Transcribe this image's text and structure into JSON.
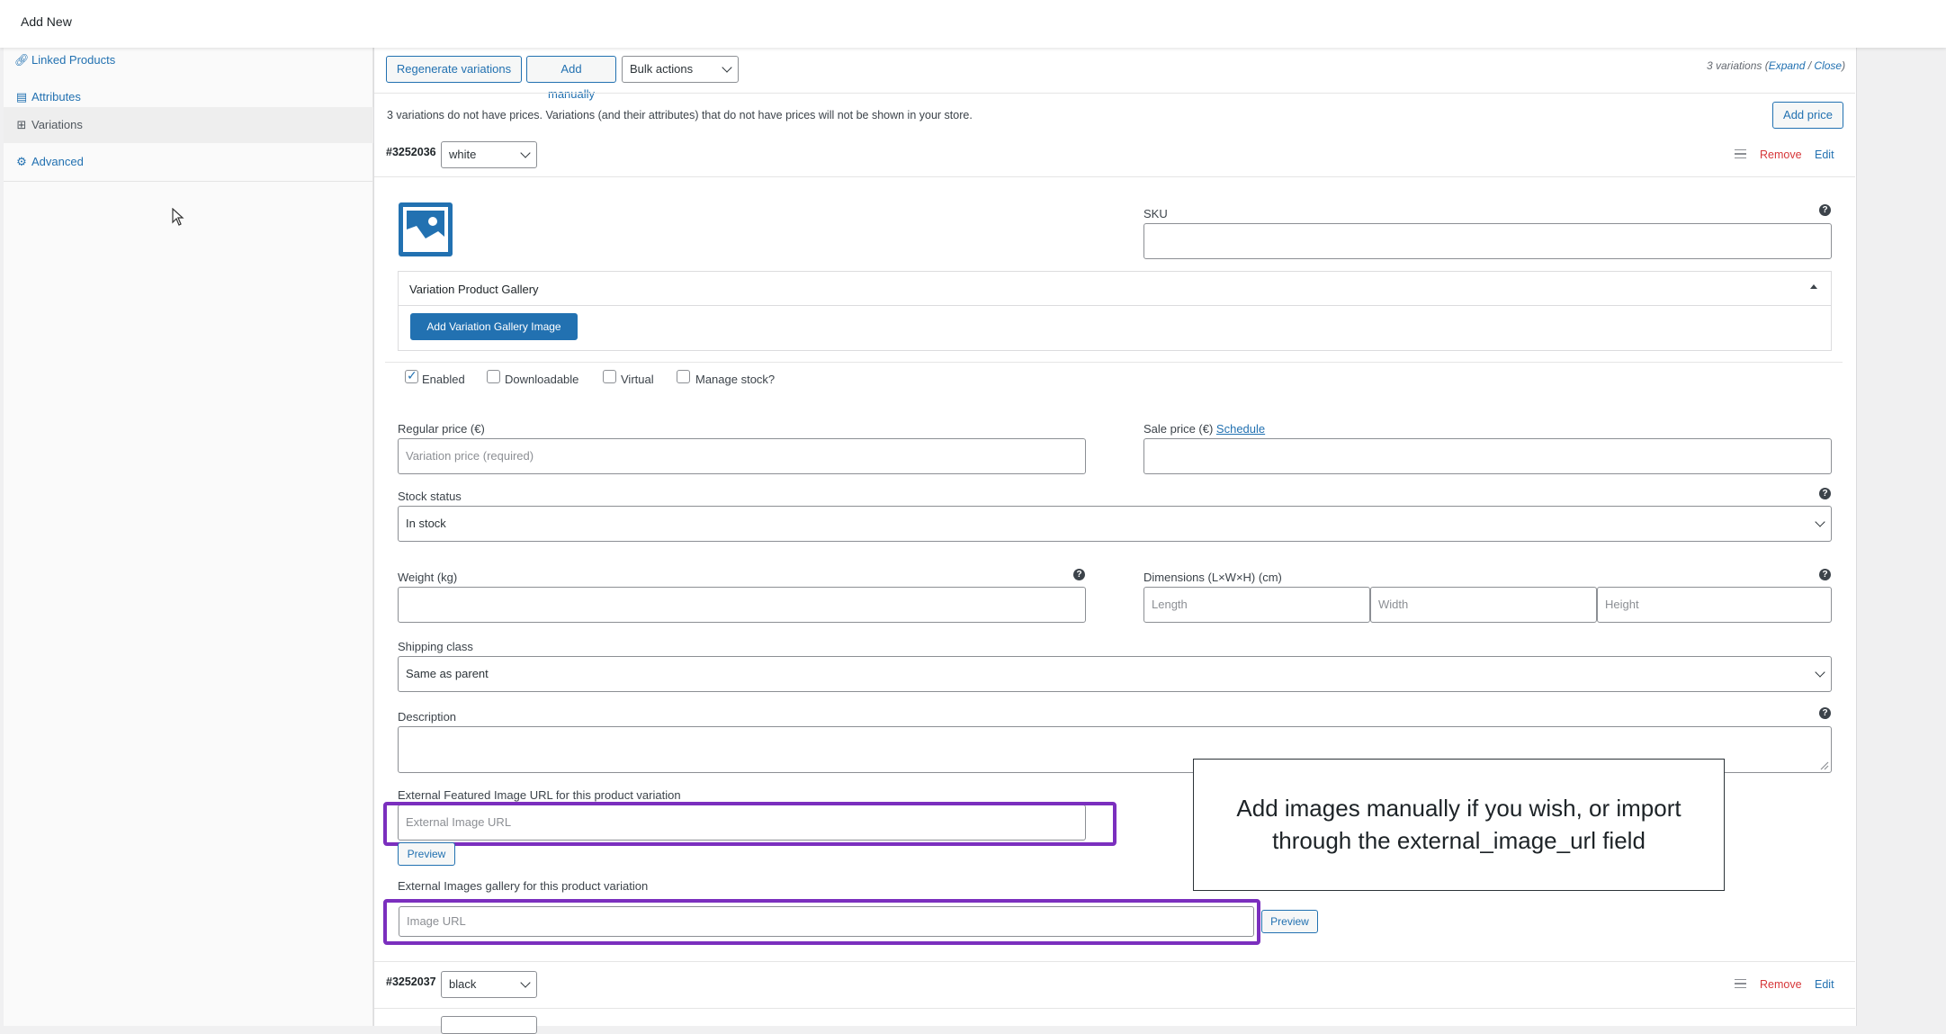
{
  "topbar": {
    "title": "Add New"
  },
  "sidebar": {
    "items": [
      {
        "label": "Linked Products",
        "icon": "link-icon"
      },
      {
        "label": "Attributes",
        "icon": "table-icon"
      },
      {
        "label": "Variations",
        "icon": "grid-icon"
      },
      {
        "label": "Advanced",
        "icon": "gear-icon"
      }
    ]
  },
  "toolbar": {
    "regenerate": "Regenerate variations",
    "add_manually": "Add manually",
    "bulk_actions": "Bulk actions",
    "count_text": "3 variations (",
    "expand": "Expand",
    "slash": " / ",
    "close": "Close",
    "close_paren": ")"
  },
  "notice": {
    "text": "3 variations do not have prices. Variations (and their attributes) that do not have prices will not be shown in your store.",
    "add_price": "Add price"
  },
  "variation1": {
    "id": "#3252036",
    "attribute_value": "white",
    "remove": "Remove",
    "edit": "Edit",
    "sku_label": "SKU",
    "gallery_title": "Variation Product Gallery",
    "add_gallery_image": "Add Variation Gallery Image",
    "enabled": "Enabled",
    "downloadable": "Downloadable",
    "virtual": "Virtual",
    "manage_stock": "Manage stock?",
    "regular_price_label": "Regular price (€)",
    "regular_price_placeholder": "Variation price (required)",
    "sale_price_label": "Sale price (€) ",
    "schedule": "Schedule",
    "stock_status_label": "Stock status",
    "stock_status_value": "In stock",
    "weight_label": "Weight (kg)",
    "dimensions_label": "Dimensions (L×W×H) (cm)",
    "length_placeholder": "Length",
    "width_placeholder": "Width",
    "height_placeholder": "Height",
    "shipping_class_label": "Shipping class",
    "shipping_class_value": "Same as parent",
    "description_label": "Description",
    "ext_featured_label": "External Featured Image URL for this product variation",
    "ext_featured_placeholder": "External Image URL",
    "preview": "Preview",
    "ext_gallery_label": "External Images gallery for this product variation",
    "ext_gallery_placeholder": "Image URL",
    "preview2": "Preview"
  },
  "variation2": {
    "id": "#3252037",
    "attribute_value": "black",
    "remove": "Remove",
    "edit": "Edit"
  },
  "callout": {
    "text": "Add images manually if you wish, or import through the external_image_url field"
  },
  "colors": {
    "accent": "#2271b1",
    "highlight": "#7b2fbe",
    "remove": "#d63638"
  }
}
